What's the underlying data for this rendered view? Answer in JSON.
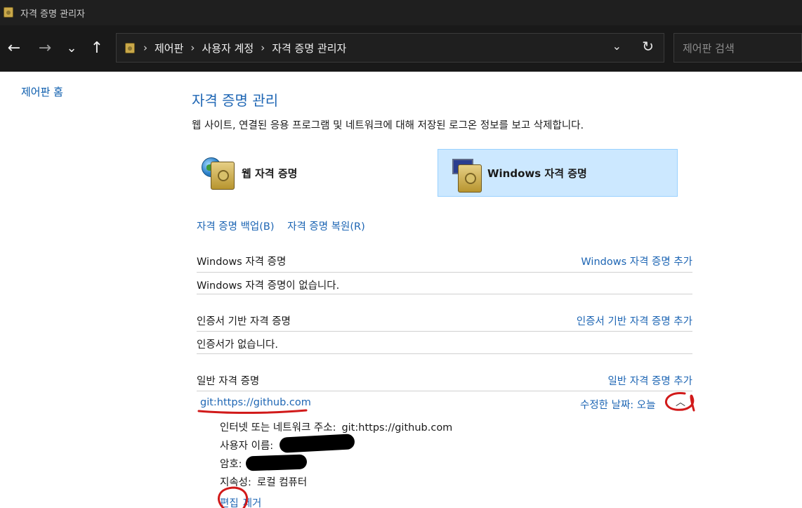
{
  "window": {
    "title": "자격 증명 관리자"
  },
  "nav": {
    "back": "←",
    "forward": "→",
    "recent": "⌄",
    "up": "↑",
    "breadcrumb": [
      "제어판",
      "사용자 계정",
      "자격 증명 관리자"
    ],
    "separator": "›",
    "dropdown": "⌄",
    "refresh": "↻",
    "search_placeholder": "제어판 검색"
  },
  "sidebar": {
    "home_link": "제어판 홈"
  },
  "main": {
    "heading": "자격 증명 관리",
    "description": "웹 사이트, 연결된 응용 프로그램 및 네트워크에 대해 저장된 로그온 정보를 보고 삭제합니다.",
    "tiles": {
      "web": "웹 자격 증명",
      "windows": "Windows 자격 증명"
    },
    "backup_link": "자격 증명 백업(B)",
    "restore_link": "자격 증명 복원(R)",
    "sections": {
      "windows": {
        "title": "Windows 자격 증명",
        "add": "Windows 자격 증명 추가",
        "empty": "Windows 자격 증명이 없습니다."
      },
      "certificate": {
        "title": "인증서 기반 자격 증명",
        "add": "인증서 기반 자격 증명 추가",
        "empty": "인증서가 없습니다."
      },
      "generic": {
        "title": "일반 자격 증명",
        "add": "일반 자격 증명 추가"
      }
    },
    "credential": {
      "name": "git:https://github.com",
      "modified": "수정한 날짜: 오늘",
      "chevron": "︿",
      "address_label": "인터넷 또는 네트워크 주소:",
      "address_value": "git:https://github.com",
      "username_label": "사용자 이름:",
      "password_label": "암호:",
      "persistence_label": "지속성:",
      "persistence_value": "로컬 컴퓨터",
      "edit": "편집",
      "remove": "제거"
    }
  },
  "colors": {
    "link": "#1e66b4",
    "selected_tile": "#cce8ff",
    "annotation": "#d11a1a"
  }
}
